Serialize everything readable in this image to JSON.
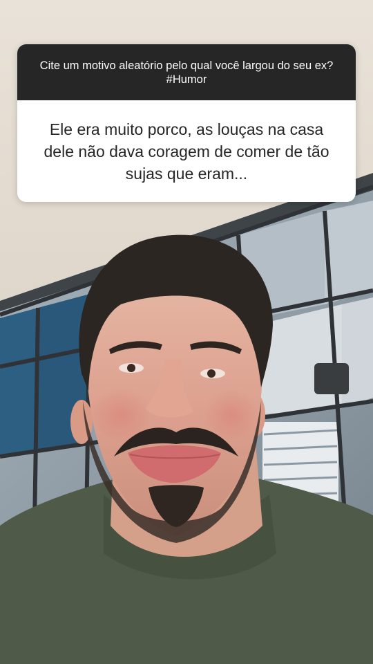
{
  "question_sticker": {
    "question": "Cite um motivo aleatório pelo qual você largou do seu ex? #Humor",
    "answer": "Ele era muito porco, as louças na casa dele não dava coragem de comer de tão sujas que eram..."
  },
  "colors": {
    "question_background": "#262626",
    "answer_background": "#ffffff",
    "shirt": "#4f5b48"
  }
}
